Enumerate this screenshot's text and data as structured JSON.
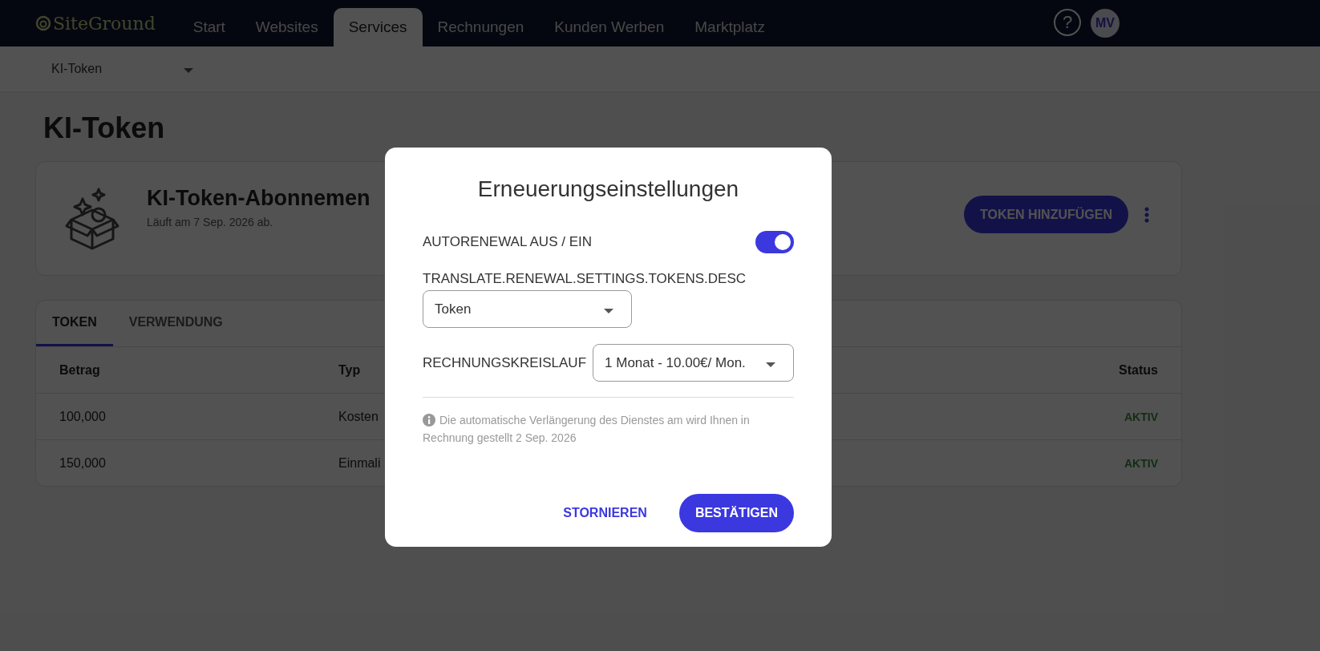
{
  "nav": {
    "logo": "SiteGround",
    "items": [
      {
        "label": "Start",
        "selected": false
      },
      {
        "label": "Websites",
        "selected": false
      },
      {
        "label": "Services",
        "selected": true
      },
      {
        "label": "Rechnungen",
        "selected": false
      },
      {
        "label": "Kunden Werben",
        "selected": false
      },
      {
        "label": "Marktplatz",
        "selected": false
      }
    ],
    "help": "?",
    "avatar": "MV"
  },
  "subnav": {
    "dropdown": "KI-Token"
  },
  "page_title": "KI-Token",
  "subscription": {
    "title": "KI-Token-Abonnemen",
    "expiry": "Läuft am 7 Sep. 2026 ab.",
    "add_button": "TOKEN HINZUFÜGEN"
  },
  "tabs": [
    {
      "label": "TOKEN",
      "selected": true
    },
    {
      "label": "VERWENDUNG",
      "selected": false
    }
  ],
  "table": {
    "columns": [
      "Betrag",
      "Typ",
      "Status"
    ],
    "rows": [
      {
        "amount": "100,000",
        "type": "Kosten",
        "status": "AKTIV"
      },
      {
        "amount": "150,000",
        "type": "Einmali",
        "status": "AKTIV"
      }
    ]
  },
  "dialog": {
    "title": "Erneuerungseinstellungen",
    "autorenew_label": "AUTORENEWAL AUS / EIN",
    "autorenew_on": true,
    "desc_label": "TRANSLATE.RENEWAL.SETTINGS.TOKENS.DESC",
    "token_select": "Token",
    "billing_label": "RECHNUNGSKREISLAUF",
    "billing_select": "1 Monat - 10.00€/ Mon.",
    "info": "Die automatische Verlängerung des Dienstes am wird Ihnen in Rechnung gestellt 2 Sep. 2026",
    "cancel": "STORNIEREN",
    "confirm": "BESTÄTIGEN"
  }
}
